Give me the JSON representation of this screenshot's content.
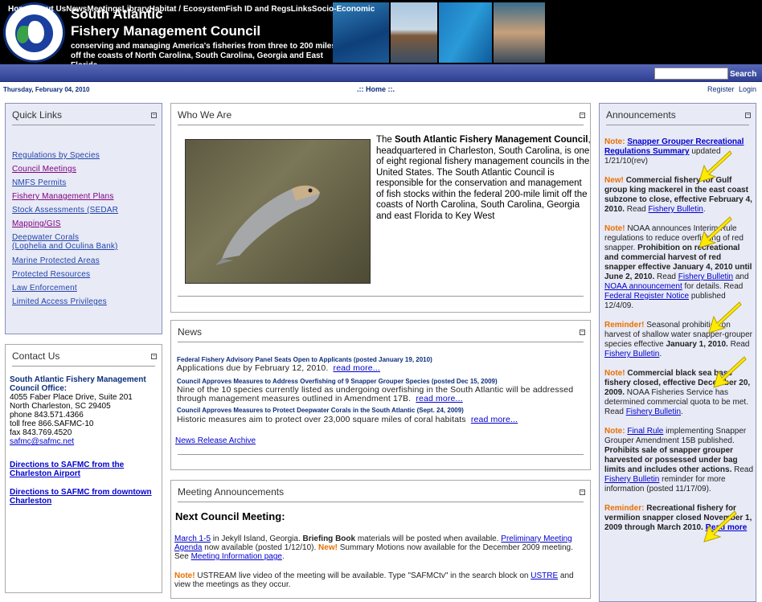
{
  "header": {
    "title_line1": "South Atlantic",
    "title_line2": "Fishery Management Council",
    "tagline": "conserving and managing America's fisheries from three to 200 miles off the coasts of North Carolina, South Carolina, Georgia and East Florida"
  },
  "nav": {
    "items": [
      "Home",
      "About Us",
      "News",
      "Meetings",
      "Library",
      "Habitat / Ecosystem",
      "Fish ID and Regs",
      "Links",
      "Socio-Economic"
    ],
    "search_button": "Search"
  },
  "subbar": {
    "date": "Thursday, February 04, 2010",
    "home": ".:: Home ::.",
    "register": "Register",
    "login": "Login"
  },
  "quick_links": {
    "title": "Quick Links",
    "links": [
      "Regulations by Species",
      "Council Meetings",
      "NMFS Permits",
      "Fishery Management Plans",
      "Stock Assessments (SEDAR",
      "Mapping/GIS",
      "Deepwater Corals",
      "(Lophelia and Oculina Bank)",
      "Marine Protected Areas",
      "Protected Resources",
      "Law Enforcement",
      "Limited Access Privileges"
    ]
  },
  "contact": {
    "title": "Contact Us",
    "office": "South Atlantic Fishery Management Council Office:",
    "address1": "4055 Faber Place Drive, Suite 201",
    "address2": "North Charleston, SC 29405",
    "phone": "phone 843.571.4366",
    "tollfree": "toll free 866.SAFMC-10",
    "fax": "fax 843.769.4520",
    "email": "safmc@safmc.net",
    "dir_airport": "Directions to SAFMC from the Charleston Airport",
    "dir_downtown": "Directions to SAFMC from downtown Charleston"
  },
  "who": {
    "title": "Who We Are",
    "text_pre": "The ",
    "text_bold": "South Atlantic Fishery Management Council",
    "text_post": ", headquartered in Charleston, South Carolina, is one of eight regional fishery management councils in the United States. The South Atlantic Council is responsible for the conservation and management of fish stocks within the federal 200-mile limit off the coasts of North Carolina, South Carolina, Georgia and east Florida to Key West"
  },
  "news": {
    "title": "News",
    "items": [
      {
        "head": "Federal Fishery Advisory Panel Seats Open to Applicants (posted January 19, 2010)",
        "body": "Applications due by February 12, 2010.",
        "more": "read more..."
      },
      {
        "head": "Council Approves Measures to Address Overfishing of 9 Snapper Grouper Species (posted Dec 15, 2009)",
        "body1": "Nine of the 10 species currently listed as undergoing overfishing in the South Atlantic will be addressed",
        "body2": "through management measures outlined in Amendment 17B.",
        "more": "read more..."
      },
      {
        "head": "Council Approves Measures to Protect Deepwater Corals in the South Atlantic (Sept. 24, 2009)",
        "body": "Historic measures aim to protect over 23,000 square miles of coral habitats",
        "more": "read more..."
      }
    ],
    "archive": "News Release Archive"
  },
  "meeting": {
    "title": "Meeting Announcements",
    "next": "Next Council Meeting",
    "date_link": "March 1-5",
    "text1": " in Jekyll Island, Georgia. ",
    "briefing": "Briefing Book",
    "text2": " materials will be posted when available. ",
    "agenda": "Preliminary Meeting Agenda",
    "text3": " now available (posted 1/12/10). ",
    "new": "New!",
    "text4": " Summary Motions now available for the December 2009 meeting. See ",
    "info": "Meeting Information page",
    "note": "Note!",
    "ustream": "  USTREAM live video of the meeting will be available. Type \"SAFMCtv\" in the search block on ",
    "ustream_link": "USTRE",
    "ustream_end": "and view the meetings as they occur."
  },
  "announcements": {
    "title": "Announcements"
  }
}
